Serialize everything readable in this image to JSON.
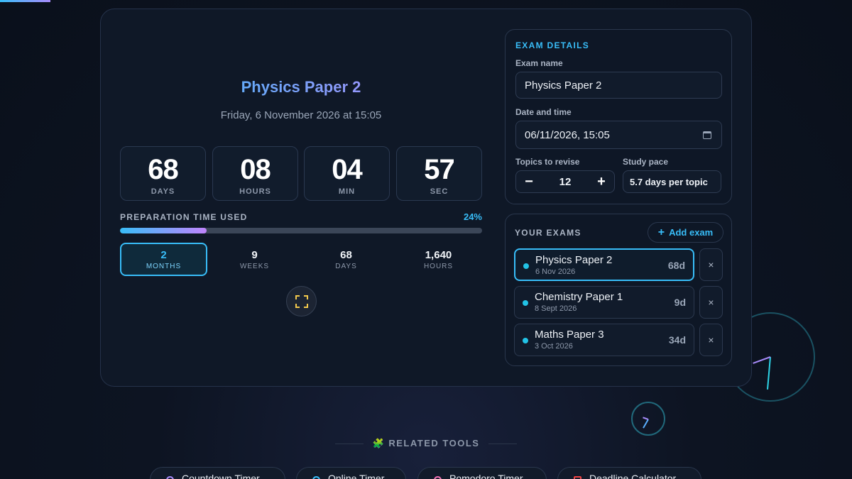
{
  "countdown": {
    "exam_title": "Physics Paper 2",
    "exam_datetime": "Friday, 6 November 2026 at 15:05",
    "units": [
      {
        "value": "68",
        "label": "DAYS"
      },
      {
        "value": "08",
        "label": "HOURS"
      },
      {
        "value": "04",
        "label": "MIN"
      },
      {
        "value": "57",
        "label": "SEC"
      }
    ],
    "preparation": {
      "label": "PREPARATION TIME USED",
      "percent_text": "24%",
      "percent": 24
    },
    "alt_units": [
      {
        "value": "2",
        "label": "MONTHS",
        "active": true
      },
      {
        "value": "9",
        "label": "WEEKS",
        "active": false
      },
      {
        "value": "68",
        "label": "DAYS",
        "active": false
      },
      {
        "value": "1,640",
        "label": "HOURS",
        "active": false
      }
    ],
    "fullscreen_icon": "fullscreen-icon"
  },
  "exam_details": {
    "title": "EXAM DETAILS",
    "name_label": "Exam name",
    "name_value": "Physics Paper 2",
    "datetime_label": "Date and time",
    "datetime_value": "06/11/2026, 15:05",
    "topics_label": "Topics to revise",
    "topics_value": "12",
    "decrement": "−",
    "increment": "+",
    "pace_label": "Study pace",
    "pace_value": "5.7 days per topic"
  },
  "your_exams": {
    "title": "YOUR EXAMS",
    "add_label": "Add exam",
    "add_icon": "+",
    "delete_icon": "×",
    "items": [
      {
        "name": "Physics Paper 2",
        "date": "6 Nov 2026",
        "days": "68d",
        "active": true
      },
      {
        "name": "Chemistry Paper 1",
        "date": "8 Sept 2026",
        "days": "9d",
        "active": false
      },
      {
        "name": "Maths Paper 3",
        "date": "3 Oct 2026",
        "days": "34d",
        "active": false
      }
    ]
  },
  "related": {
    "title": "🧩 RELATED TOOLS",
    "tools": [
      "Countdown Timer",
      "Online Timer",
      "Pomodoro Timer",
      "Deadline Calculator"
    ]
  },
  "colors": {
    "accent": "#38bdf8",
    "accent2": "#c084fc",
    "card": "#0f1827"
  }
}
